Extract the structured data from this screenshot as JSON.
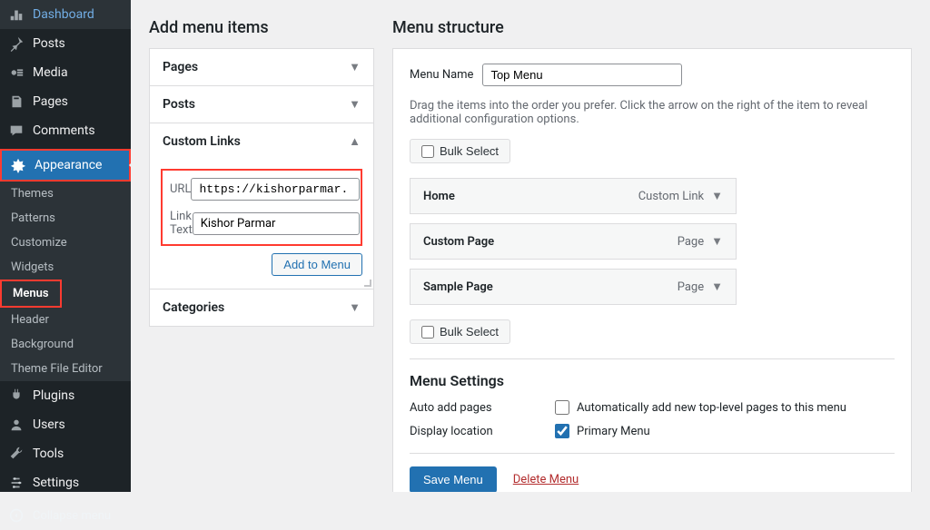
{
  "sidebar": {
    "items": [
      {
        "label": "Dashboard",
        "icon": "dashboard"
      },
      {
        "label": "Posts",
        "icon": "pin"
      },
      {
        "label": "Media",
        "icon": "media"
      },
      {
        "label": "Pages",
        "icon": "pages"
      },
      {
        "label": "Comments",
        "icon": "comments"
      },
      {
        "label": "Appearance",
        "icon": "appearance",
        "active": true,
        "highlight": true
      },
      {
        "label": "Plugins",
        "icon": "plugins"
      },
      {
        "label": "Users",
        "icon": "users"
      },
      {
        "label": "Tools",
        "icon": "tools"
      },
      {
        "label": "Settings",
        "icon": "settings"
      }
    ],
    "appearance_submenu": [
      "Themes",
      "Patterns",
      "Customize",
      "Widgets",
      "Menus",
      "Header",
      "Background",
      "Theme File Editor"
    ],
    "submenu_current": "Menus",
    "collapse_label": "Collapse menu"
  },
  "add_menu": {
    "heading": "Add menu items",
    "accordions": {
      "pages": "Pages",
      "posts": "Posts",
      "custom_links": "Custom Links",
      "categories": "Categories"
    },
    "custom": {
      "url_label": "URL",
      "url_value": "https://kishorparmar.",
      "text_label": "Link Text",
      "text_value": "Kishor Parmar",
      "add_btn": "Add to Menu"
    }
  },
  "structure": {
    "heading": "Menu structure",
    "menu_name_label": "Menu Name",
    "menu_name_value": "Top Menu",
    "help": "Drag the items into the order you prefer. Click the arrow on the right of the item to reveal additional configuration options.",
    "bulk_select": "Bulk Select",
    "items": [
      {
        "title": "Home",
        "type": "Custom Link"
      },
      {
        "title": "Custom Page",
        "type": "Page"
      },
      {
        "title": "Sample Page",
        "type": "Page"
      }
    ],
    "settings": {
      "heading": "Menu Settings",
      "auto_add_label": "Auto add pages",
      "auto_add_cb": "Automatically add new top-level pages to this menu",
      "display_label": "Display location",
      "display_cb": "Primary Menu",
      "display_checked": true
    },
    "save_btn": "Save Menu",
    "delete_link": "Delete Menu"
  }
}
